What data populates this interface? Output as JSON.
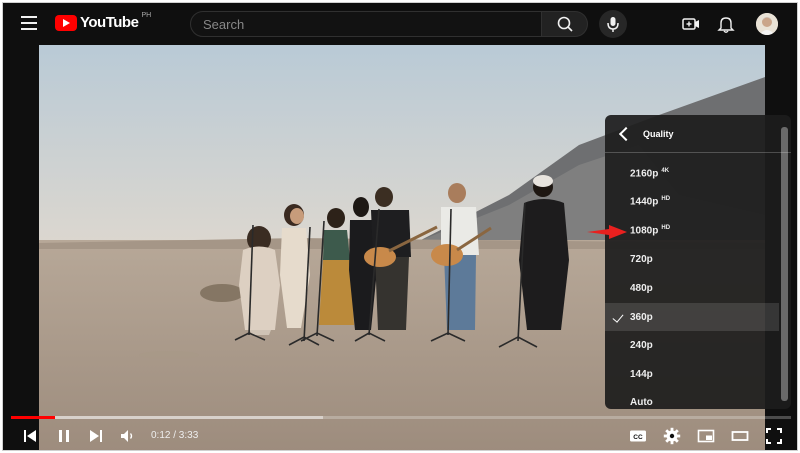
{
  "masthead": {
    "logo_text": "YouTube",
    "country_code": "PH",
    "search_placeholder": "Search",
    "icons": [
      "menu-icon",
      "youtube-logo",
      "search-icon",
      "mic-icon",
      "create-icon",
      "bell-icon",
      "avatar"
    ]
  },
  "player": {
    "time_display": "0:12 / 3:33",
    "progress_played_fraction": 0.056,
    "progress_buffered_fraction": 0.4,
    "cc_label": "CC",
    "controls": [
      "previous-icon",
      "pause-icon",
      "next-icon",
      "volume-icon",
      "cc-icon",
      "settings-icon",
      "miniplayer-icon",
      "theater-icon",
      "fullscreen-icon"
    ]
  },
  "quality_menu": {
    "title": "Quality",
    "items": [
      {
        "label": "2160p",
        "badge": "4K",
        "selected": false
      },
      {
        "label": "1440p",
        "badge": "HD",
        "selected": false
      },
      {
        "label": "1080p",
        "badge": "HD",
        "selected": false
      },
      {
        "label": "720p",
        "badge": "",
        "selected": false
      },
      {
        "label": "480p",
        "badge": "",
        "selected": false
      },
      {
        "label": "360p",
        "badge": "",
        "selected": true
      },
      {
        "label": "240p",
        "badge": "",
        "selected": false
      },
      {
        "label": "144p",
        "badge": "",
        "selected": false
      },
      {
        "label": "Auto",
        "badge": "",
        "selected": false
      }
    ]
  },
  "colors": {
    "accent": "#ff0000",
    "menu_bg": "#1c1c1c",
    "background": "#0f0f0f",
    "annotation_arrow": "#e8201f"
  }
}
